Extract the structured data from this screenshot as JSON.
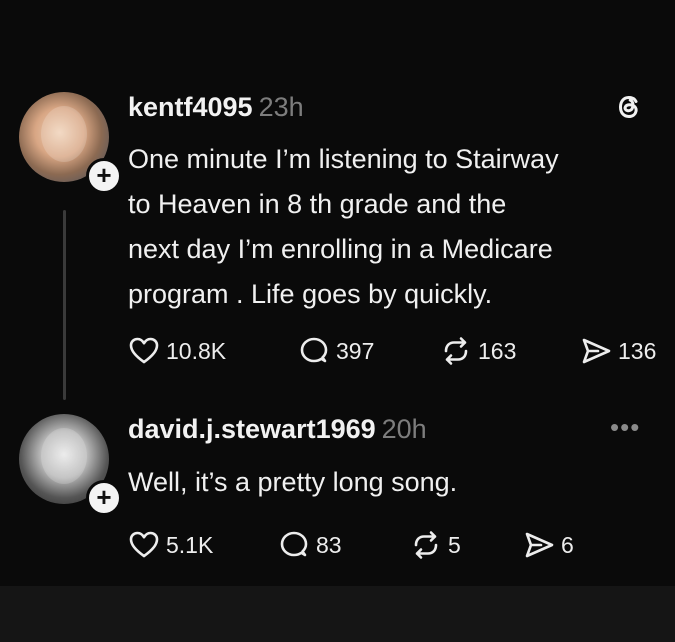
{
  "posts": [
    {
      "username": "kentf4095",
      "timestamp": "23h",
      "text_lines": [
        "One minute I’m listening to Stairway",
        "to Heaven in 8 th grade and the",
        "next day I’m enrolling in a Medicare",
        "program . Life goes by quickly."
      ],
      "likes": "10.8K",
      "replies": "397",
      "reposts": "163",
      "shares": "136",
      "top_right_icon": "threads-logo-icon"
    },
    {
      "username": "david.j.stewart1969",
      "timestamp": "20h",
      "text_lines": [
        "Well, it’s a pretty long song."
      ],
      "likes": "5.1K",
      "replies": "83",
      "reposts": "5",
      "shares": "6",
      "top_right_icon": "more-options-icon"
    }
  ],
  "colors": {
    "background": "#0a0a0a",
    "text": "#f2f2f2",
    "muted": "#7d7d7d",
    "thread_line": "#3a3a3a"
  },
  "icons": {
    "like": "heart-icon",
    "reply": "comment-bubble-icon",
    "repost": "repost-arrows-icon",
    "share": "send-icon",
    "follow": "plus-icon"
  }
}
